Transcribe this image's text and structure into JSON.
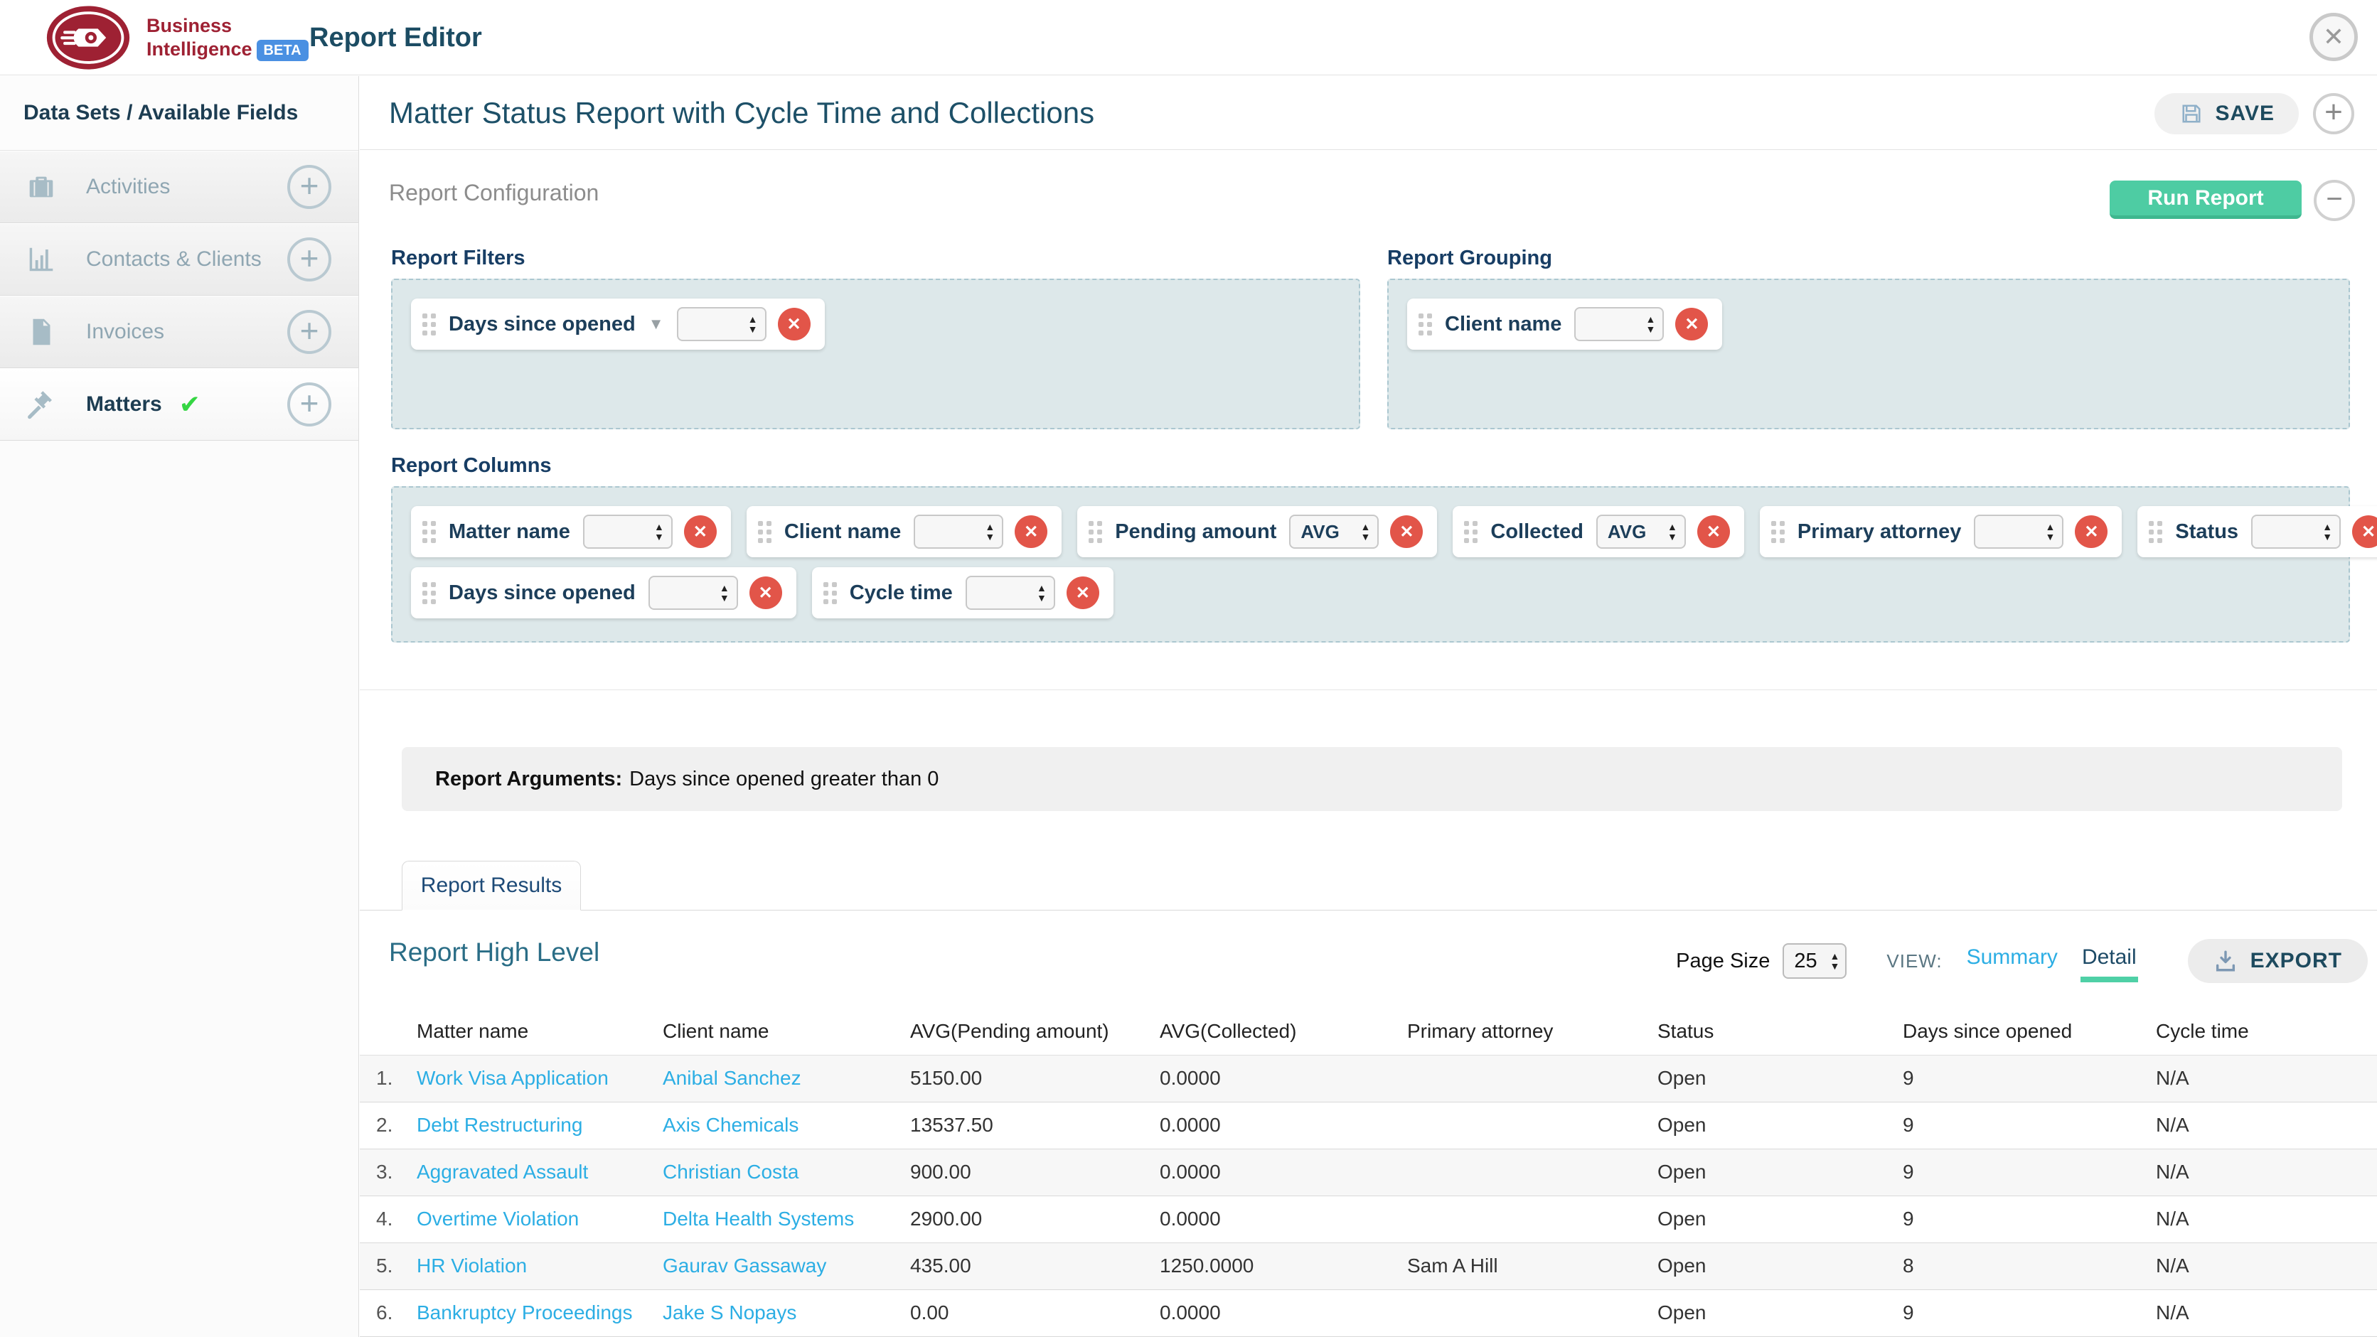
{
  "colors": {
    "brand_red": "#9e2133",
    "beta_blue": "#4a90e2",
    "heading_teal": "#1c4c63",
    "navy": "#1a3e5e",
    "run_teal": "#4ecca3",
    "run_teal_dark": "#3fb78f",
    "remove_red": "#e25549",
    "link_blue": "#2caee4",
    "check_green": "#35d643",
    "zone_bg": "#dde8ea",
    "zone_border": "#abc7d0",
    "detail_underline": "#4fd0a6"
  },
  "header": {
    "brand_line1": "Business",
    "brand_line2": "Intelligence",
    "beta": "BETA",
    "title": "Report Editor"
  },
  "sidebar": {
    "title": "Data Sets / Available Fields",
    "items": [
      {
        "label": "Activities",
        "icon": "briefcase-icon",
        "selected": false
      },
      {
        "label": "Contacts & Clients",
        "icon": "bar-chart-icon",
        "selected": false
      },
      {
        "label": "Invoices",
        "icon": "document-icon",
        "selected": false
      },
      {
        "label": "Matters",
        "icon": "gavel-icon",
        "selected": true
      }
    ]
  },
  "report": {
    "title": "Matter Status Report with Cycle Time and Collections",
    "save": "SAVE",
    "config_heading": "Report Configuration",
    "run_button": "Run Report",
    "filters_heading": "Report Filters",
    "filter_chips": [
      {
        "label": "Days since opened"
      }
    ],
    "grouping_heading": "Report Grouping",
    "grouping_chips": [
      {
        "label": "Client name"
      }
    ],
    "columns_heading": "Report Columns",
    "column_rows": [
      [
        {
          "label": "Matter name",
          "agg": ""
        },
        {
          "label": "Client name",
          "agg": ""
        },
        {
          "label": "Pending amount",
          "agg": "AVG"
        },
        {
          "label": "Collected",
          "agg": "AVG"
        },
        {
          "label": "Primary attorney",
          "agg": ""
        },
        {
          "label": "Status",
          "agg": ""
        }
      ],
      [
        {
          "label": "Days since opened",
          "agg": ""
        },
        {
          "label": "Cycle time",
          "agg": ""
        }
      ]
    ],
    "arguments_label": "Report Arguments:",
    "arguments_text": "Days since opened greater than 0"
  },
  "results": {
    "tab": "Report Results",
    "heading": "Report High Level",
    "page_size_label": "Page Size",
    "page_size_value": "25",
    "view_label": "VIEW:",
    "views": [
      {
        "label": "Summary",
        "active": false
      },
      {
        "label": "Detail",
        "active": true
      }
    ],
    "export": "EXPORT",
    "table": {
      "columns": [
        "Matter name",
        "Client name",
        "AVG(Pending amount)",
        "AVG(Collected)",
        "Primary attorney",
        "Status",
        "Days since opened",
        "Cycle time"
      ],
      "rows": [
        [
          "1.",
          "Work Visa Application",
          "Anibal Sanchez",
          "5150.00",
          "0.0000",
          "",
          "Open",
          "9",
          "N/A"
        ],
        [
          "2.",
          "Debt Restructuring",
          "Axis Chemicals",
          "13537.50",
          "0.0000",
          "",
          "Open",
          "9",
          "N/A"
        ],
        [
          "3.",
          "Aggravated Assault",
          "Christian Costa",
          "900.00",
          "0.0000",
          "",
          "Open",
          "9",
          "N/A"
        ],
        [
          "4.",
          "Overtime Violation",
          "Delta Health Systems",
          "2900.00",
          "0.0000",
          "",
          "Open",
          "9",
          "N/A"
        ],
        [
          "5.",
          "HR Violation",
          "Gaurav Gassaway",
          "435.00",
          "1250.0000",
          "Sam A Hill",
          "Open",
          "8",
          "N/A"
        ],
        [
          "6.",
          "Bankruptcy Proceedings",
          "Jake S Nopays",
          "0.00",
          "0.0000",
          "",
          "Open",
          "9",
          "N/A"
        ]
      ]
    }
  }
}
